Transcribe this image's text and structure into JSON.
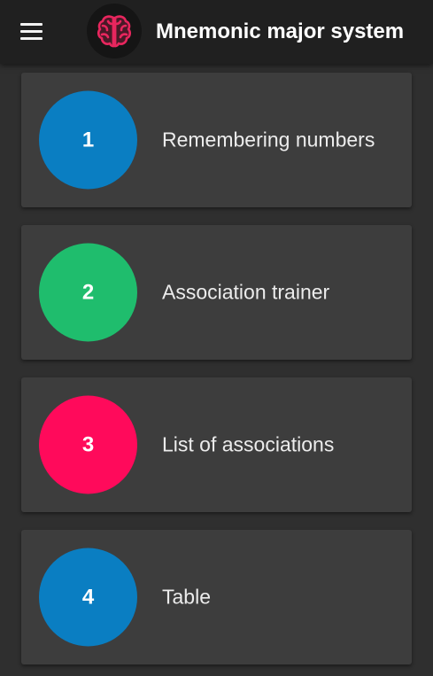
{
  "app": {
    "title": "Mnemonic major system"
  },
  "menu": [
    {
      "number": "1",
      "label": "Remembering numbers",
      "color": "#0a7ec2"
    },
    {
      "number": "2",
      "label": "Association trainer",
      "color": "#1fbd6d"
    },
    {
      "number": "3",
      "label": "List of associations",
      "color": "#ff0a5b"
    },
    {
      "number": "4",
      "label": "Table",
      "color": "#0a7ec2"
    }
  ],
  "theme": {
    "background": "#2f2f2f",
    "appbar": "#202020",
    "card": "#3d3d3d",
    "logo_accent": "#e8265e"
  },
  "icons": {
    "menu": "hamburger-icon",
    "logo": "brain-icon"
  }
}
